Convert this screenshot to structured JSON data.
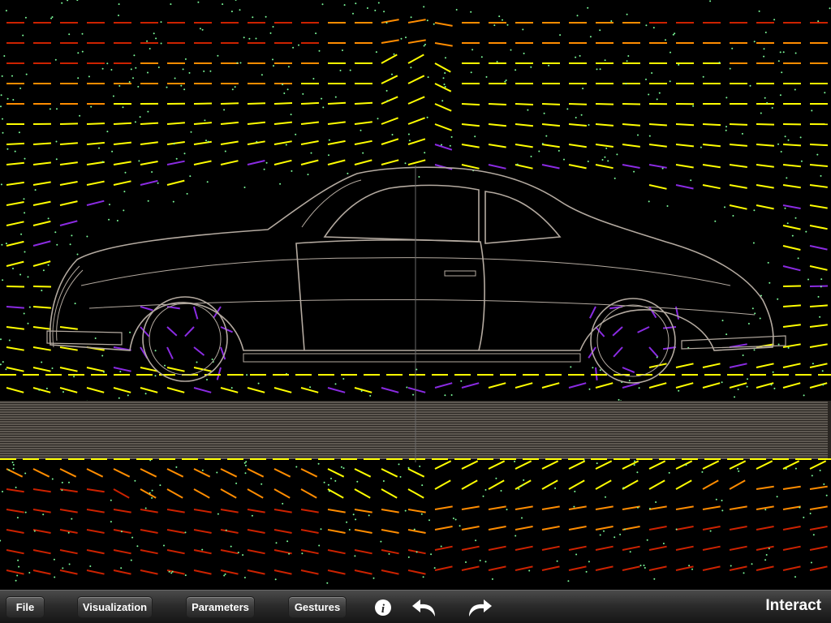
{
  "toolbar": {
    "file_label": "File",
    "visualization_label": "Visualization",
    "parameters_label": "Parameters",
    "gestures_label": "Gestures",
    "info_icon": "info-icon",
    "undo_icon": "undo-arrow-icon",
    "redo_icon": "redo-arrow-icon",
    "mode_label": "Interact"
  },
  "visualization": {
    "description_kind": "flow-field-around-car",
    "colors": {
      "background": "#000000",
      "fast_flow": "#ffff00",
      "medium_flow": "#ff8c00",
      "slow_flow": "#cc2200",
      "vortex_flow": "#8a2be2",
      "particles": "#7cfc9a",
      "outline": "#b4aaa0"
    }
  }
}
